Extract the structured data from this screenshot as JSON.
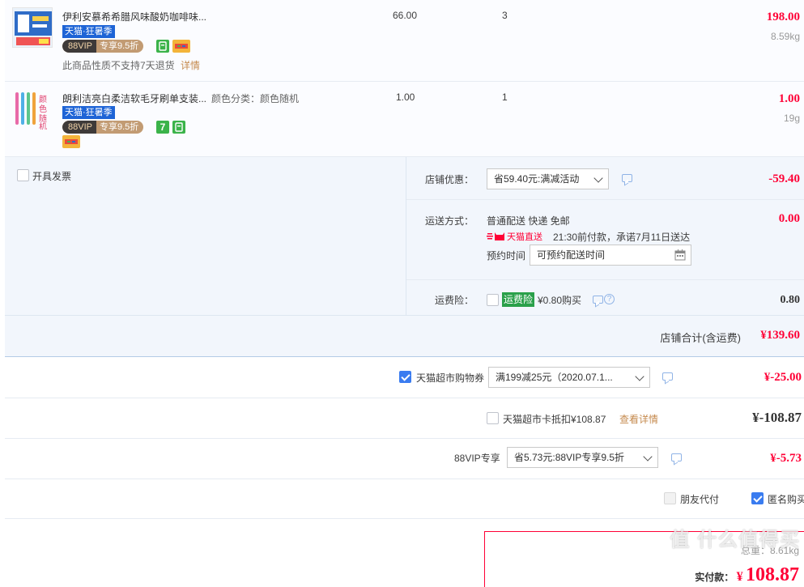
{
  "items": [
    {
      "title": "伊利安慕希希腊风味酸奶咖啡味...",
      "sku": "",
      "tag_tmall": "天猫·狂暑季",
      "tag_88_left": "88VIP",
      "tag_88_right": "专享9.5折",
      "price": "66.00",
      "qty": "3",
      "subtotal": "198.00",
      "weight": "8.59kg",
      "notice": "此商品性质不支持7天退货",
      "notice_link": "详情"
    },
    {
      "title": "朗利洁亮白柔洁软毛牙刷单支装...",
      "sku": "颜色分类：颜色随机",
      "tag_tmall": "天猫·狂暑季",
      "tag_88_left": "88VIP",
      "tag_88_right": "专享9.5折",
      "badge_seven": "7",
      "price": "1.00",
      "qty": "1",
      "subtotal": "1.00",
      "weight": "19g"
    }
  ],
  "invoice": {
    "label": "开具发票"
  },
  "store_discount": {
    "label": "店铺优惠：",
    "select": "省59.40元:满减活动",
    "amount": "-59.40"
  },
  "shipping": {
    "label": "运送方式：",
    "method": "普通配送 快递 免邮",
    "amount": "0.00",
    "tmall_direct": "天猫直送",
    "promise": "21:30前付款，承诺7月11日送达",
    "reserve_label": "预约时间",
    "reserve_placeholder": "可预约配送时间"
  },
  "insurance": {
    "label": "运费险：",
    "tag": "运费险",
    "price_text": "¥0.80购买",
    "amount": "0.80"
  },
  "store_total": {
    "label": "店铺合计(含运费)",
    "amount": "¥139.60"
  },
  "coupon": {
    "label": "天猫超市购物券",
    "select": "满199减25元（2020.07.1...",
    "amount": "¥-25.00"
  },
  "card": {
    "label": "天猫超市卡抵扣¥108.87",
    "link": "查看详情",
    "amount": "¥-108.87"
  },
  "vip88": {
    "label": "88VIP专享",
    "select": "省5.73元:88VIP专享9.5折",
    "amount": "¥-5.73"
  },
  "options": {
    "friend_pay": "朋友代付",
    "anonymous": "匿名购买"
  },
  "footer": {
    "weight_label": "总重：",
    "weight": "8.61kg",
    "pay_label": "实付款：",
    "currency": "¥",
    "pay_amount": "108.87"
  },
  "watermark": "值 什么值得买",
  "colors": {
    "accent_red": "#ff0036",
    "tmall_blue": "#1e64d6",
    "panel_bg": "#f2f6fc",
    "check_blue": "#3a7cf0"
  }
}
